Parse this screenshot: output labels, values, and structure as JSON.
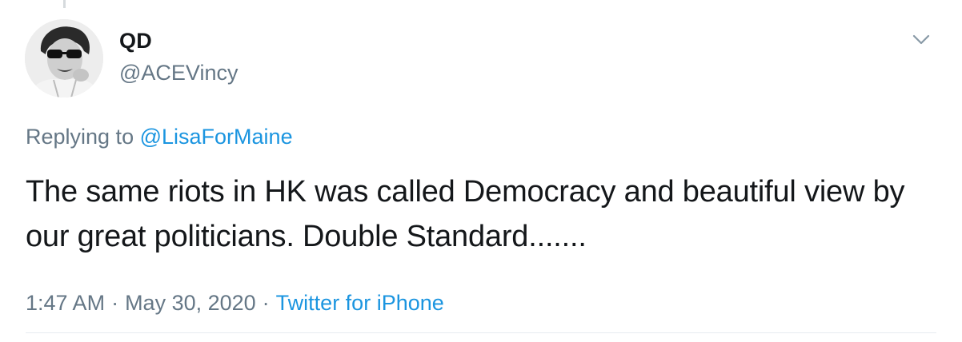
{
  "tweet": {
    "author": {
      "display_name": "QD",
      "handle": "@ACEVincy",
      "avatar_icon": "profile-photo"
    },
    "more_icon": "chevron-down-icon",
    "reply": {
      "prefix": "Replying to",
      "mention": "@LisaForMaine"
    },
    "text": "The same riots in HK was called Democracy and beautiful view by our great politicians. Double Standard.......",
    "meta": {
      "time": "1:47 AM",
      "separator": "·",
      "date": "May 30, 2020",
      "source": "Twitter for iPhone"
    },
    "colors": {
      "link": "#1b95e0",
      "secondary_text": "#657786",
      "primary_text": "#14171a"
    }
  }
}
